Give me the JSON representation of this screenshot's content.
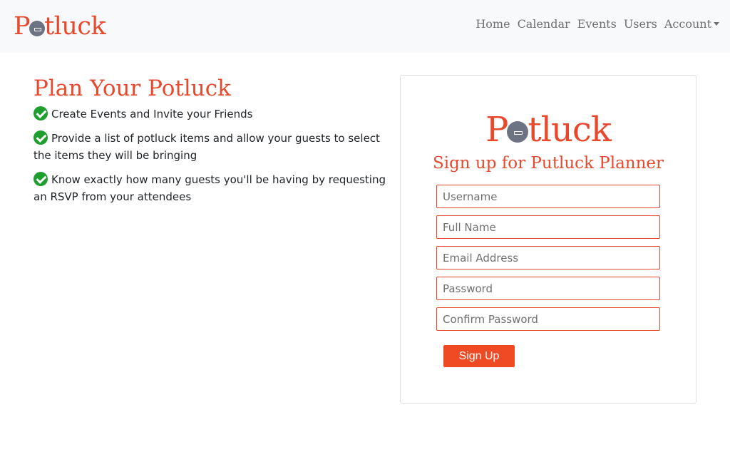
{
  "brand": {
    "logo_prefix": "P",
    "logo_suffix": "tluck",
    "color": "#e8492c"
  },
  "nav": {
    "home": "Home",
    "calendar": "Calendar",
    "events": "Events",
    "users": "Users",
    "account": "Account"
  },
  "intro": {
    "heading": "Plan Your Potluck",
    "features": [
      "Create Events and Invite your Friends",
      "Provide a list of potluck items and allow your guests to select the items they will be bringing",
      "Know exactly how many guests you'll be having by requesting an RSVP from your attendees"
    ],
    "check_icon": "check-circle-icon",
    "check_color": "#1e9e2c"
  },
  "signup": {
    "logo_prefix": "P",
    "logo_suffix": "tluck",
    "title": "Sign up for Putluck Planner",
    "fields": {
      "username": {
        "placeholder": "Username",
        "value": ""
      },
      "full_name": {
        "placeholder": "Full Name",
        "value": ""
      },
      "email": {
        "placeholder": "Email Address",
        "value": ""
      },
      "password": {
        "placeholder": "Password",
        "value": ""
      },
      "confirm_password": {
        "placeholder": "Confirm Password",
        "value": ""
      }
    },
    "submit_label": "Sign Up",
    "button_color": "#f04a24"
  }
}
